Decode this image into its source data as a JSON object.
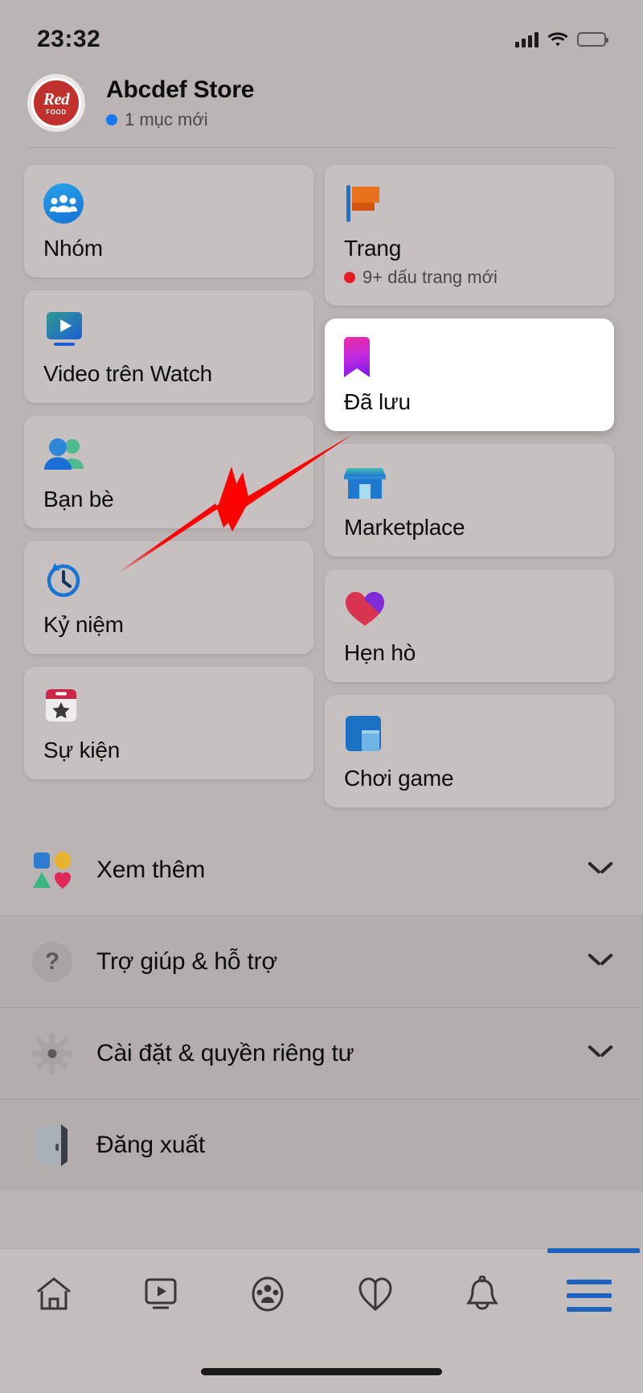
{
  "status_bar": {
    "time": "23:32",
    "signal_icon": "cellular-signal-icon",
    "wifi_icon": "wifi-icon",
    "battery_icon": "battery-low-power-icon",
    "battery_color": "#e8b500"
  },
  "header": {
    "avatar_text_top": "Red",
    "avatar_text_bottom": "FOOD",
    "avatar_name": "red-food-logo",
    "store_name": "Abcdef Store",
    "badge_text": "1 mục mới",
    "badge_dot_color": "#1878f2"
  },
  "grid": {
    "left_column": [
      {
        "label": "Nhóm",
        "icon": "groups-icon"
      },
      {
        "label": "Video trên Watch",
        "icon": "watch-video-icon"
      },
      {
        "label": "Bạn bè",
        "icon": "friends-icon"
      },
      {
        "label": "Kỷ niệm",
        "icon": "memories-clock-icon"
      },
      {
        "label": "Sự kiện",
        "icon": "events-calendar-icon"
      }
    ],
    "right_column": [
      {
        "label": "Trang",
        "icon": "pages-flag-icon",
        "sub": "9+ dấu trang mới",
        "sub_dot_color": "#e81c24"
      },
      {
        "label": "Đã lưu",
        "icon": "saved-bookmark-icon",
        "highlighted": true
      },
      {
        "label": "Marketplace",
        "icon": "marketplace-storefront-icon"
      },
      {
        "label": "Hẹn hò",
        "icon": "dating-heart-icon"
      },
      {
        "label": "Chơi game",
        "icon": "gaming-icon"
      }
    ]
  },
  "list_rows": [
    {
      "label": "Xem thêm",
      "icon": "see-more-shapes-icon",
      "chevron": "chevron-down-icon"
    },
    {
      "label": "Trợ giúp & hỗ trợ",
      "icon": "help-question-icon",
      "chevron": "chevron-down-icon"
    },
    {
      "label": "Cài đặt & quyền riêng tư",
      "icon": "settings-gear-icon",
      "chevron": "chevron-down-icon"
    },
    {
      "label": "Đăng xuất",
      "icon": "logout-door-icon",
      "chevron": ""
    }
  ],
  "help_icon_glyph": "?",
  "bottom_nav": {
    "items": [
      {
        "name": "home-icon",
        "active": false
      },
      {
        "name": "watch-icon",
        "active": false
      },
      {
        "name": "groups-icon",
        "active": false
      },
      {
        "name": "marketplace-icon",
        "active": false
      },
      {
        "name": "notifications-bell-icon",
        "active": false
      },
      {
        "name": "menu-hamburger-icon",
        "active": true
      }
    ],
    "active_color": "#1e63bf"
  },
  "annotation": {
    "arrow_color": "#ff0000",
    "name": "red-pointer-arrow"
  }
}
